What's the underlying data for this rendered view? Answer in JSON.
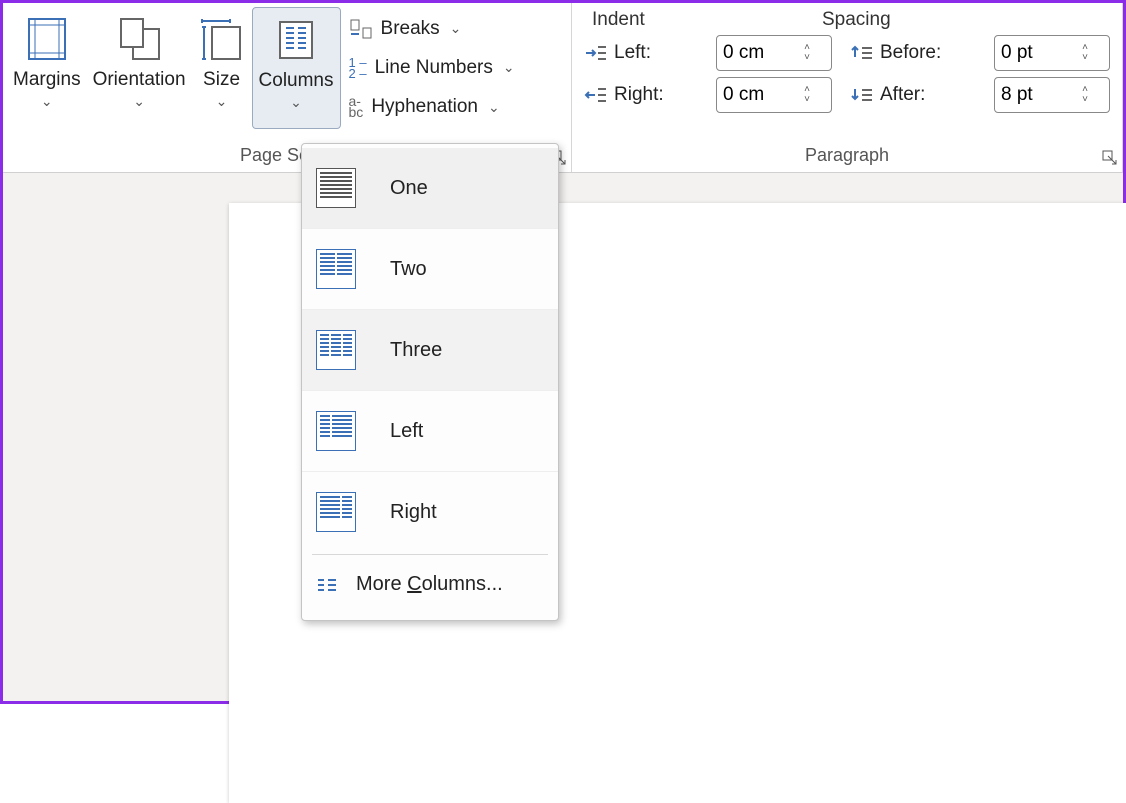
{
  "ribbon": {
    "page_setup": {
      "label": "Page Setup",
      "margins": "Margins",
      "orientation": "Orientation",
      "size": "Size",
      "columns": "Columns",
      "breaks": "Breaks",
      "line_numbers": "Line Numbers",
      "hyphenation": "Hyphenation"
    },
    "paragraph": {
      "label": "Paragraph",
      "indent_header": "Indent",
      "spacing_header": "Spacing",
      "left_label": "Left:",
      "right_label": "Right:",
      "before_label": "Before:",
      "after_label": "After:",
      "left_value": "0 cm",
      "right_value": "0 cm",
      "before_value": "0 pt",
      "after_value": "8 pt"
    }
  },
  "columns_menu": {
    "one": "One",
    "two": "Two",
    "three": "Three",
    "left": "Left",
    "right": "Right",
    "more_pre": "More ",
    "more_u": "C",
    "more_post": "olumns..."
  }
}
